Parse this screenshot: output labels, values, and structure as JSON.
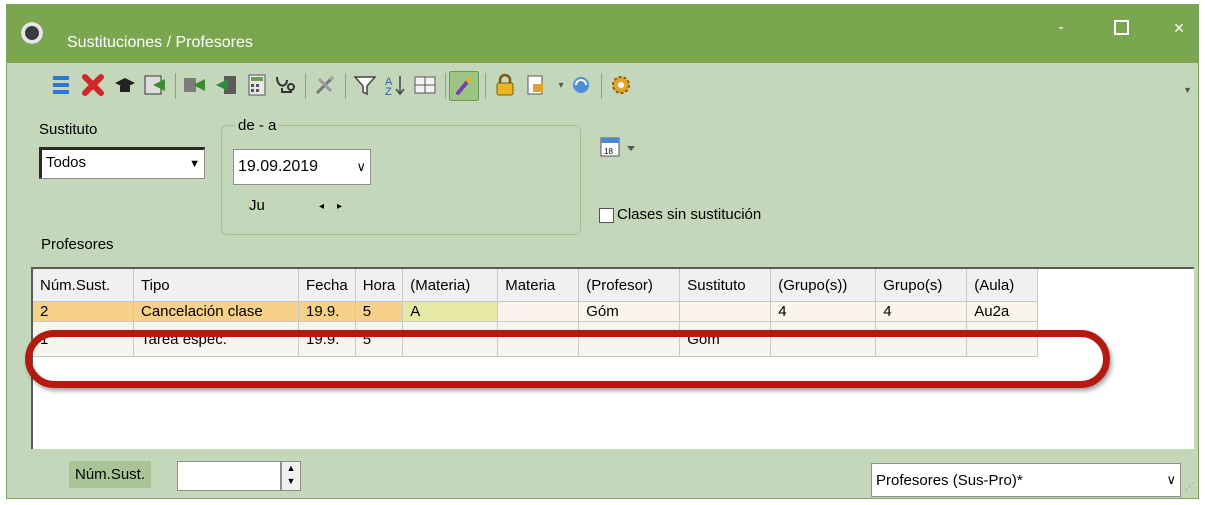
{
  "window": {
    "title": "Sustituciones / Profesores",
    "controls": {
      "minimize": "-",
      "close": "×"
    }
  },
  "toolbar": {
    "icons": [
      "list-icon",
      "delete-icon",
      "graduation-cap-icon",
      "import-icon",
      "transfer-icon",
      "export-icon",
      "calculator-icon",
      "stethoscope-icon",
      "tools-icon",
      "filter-icon",
      "sort-icon",
      "table-icon",
      "brush-icon",
      "lock-icon",
      "print-icon",
      "refresh-icon",
      "settings-icon"
    ]
  },
  "filters": {
    "sustituto_label": "Sustituto",
    "sustituto_value": "Todos",
    "range_label": "de - a",
    "date_value": "19.09.2019",
    "day_label": "Ju",
    "spin_left": "◂",
    "spin_right": "▸",
    "clases_label": "Clases sin sustitución"
  },
  "section_label": "Profesores",
  "table": {
    "columns": [
      "Núm.Sust.",
      "Tipo",
      "Fecha",
      "Hora",
      "(Materia)",
      "Materia",
      "(Profesor)",
      "Sustituto",
      "(Grupo(s))",
      "Grupo(s)",
      "(Aula)"
    ],
    "rows": [
      [
        "2",
        "Cancelación clase",
        "19.9.",
        "5",
        "A",
        "",
        "Góm",
        "",
        "4",
        "4",
        "Au2a"
      ],
      [
        "1",
        "Tarea espec.",
        "19.9.",
        "5",
        "",
        "",
        "",
        "Góm",
        "",
        "",
        ""
      ]
    ]
  },
  "bottom": {
    "num_label": "Núm.Sust.",
    "num_value": "",
    "view_value": "Profesores (Sus-Pro)*"
  },
  "colors": {
    "titlebar": "#7aa64f",
    "window_bg": "#c5d7ba",
    "highlight": "#b51a12"
  }
}
